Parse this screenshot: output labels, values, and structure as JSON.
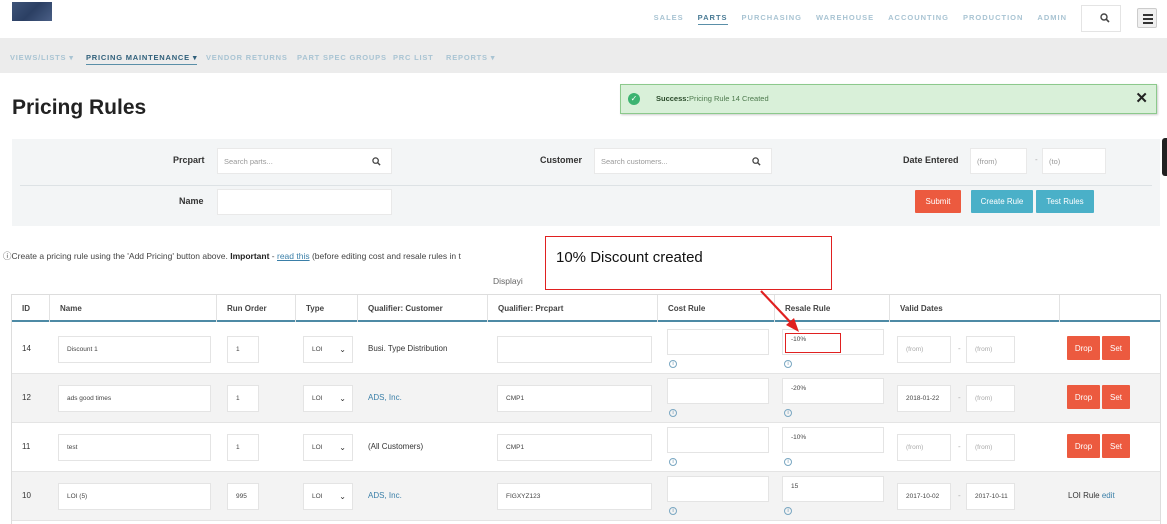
{
  "topnav": {
    "items": [
      "SALES",
      "PARTS",
      "PURCHASING",
      "WAREHOUSE",
      "ACCOUNTING",
      "PRODUCTION",
      "ADMIN"
    ],
    "active": "PARTS"
  },
  "subnav": {
    "items": [
      "VIEWS/LISTS ▾",
      "PRICING MAINTENANCE ▾",
      "VENDOR RETURNS",
      "PART SPEC GROUPS",
      "PRC LIST",
      "REPORTS ▾"
    ],
    "active": "PRICING MAINTENANCE ▾"
  },
  "page_title": "Pricing Rules",
  "alert": {
    "label": "Success:",
    "message": "Pricing Rule 14 Created",
    "close": "✕"
  },
  "filter": {
    "prcpart_label": "Prcpart",
    "prcpart_placeholder": "Search parts...",
    "customer_label": "Customer",
    "customer_placeholder": "Search customers...",
    "date_label": "Date Entered",
    "date_from": "(from)",
    "date_sep": "-",
    "date_to": "(to)",
    "name_label": "Name",
    "name_value": "",
    "submit": "Submit",
    "create_rule": "Create Rule",
    "test_rules": "Test Rules"
  },
  "info": {
    "icon": "ⓘ",
    "text1": "Create a pricing rule using the 'Add Pricing' button above. ",
    "important": "Important",
    "text2": " - ",
    "link": "read this",
    "text3": " (before editing cost and resale rules in t",
    "displaying": "Displayi"
  },
  "annotation": {
    "text": "10% Discount created"
  },
  "table": {
    "headers": [
      "ID",
      "Name",
      "Run Order",
      "Type",
      "Qualifier: Customer",
      "Qualifier: Prcpart",
      "Cost Rule",
      "Resale Rule",
      "Valid Dates",
      ""
    ],
    "rows": [
      {
        "id": "14",
        "name": "Discount 1",
        "run_order": "1",
        "type": "LOI",
        "customer": "Busi. Type Distribution",
        "customer_link": false,
        "prcpart": "",
        "cost_rule": "",
        "resale_rule": "-10%",
        "valid_from": "(from)",
        "valid_to": "(from)",
        "from_placeholder": true,
        "to_placeholder": true,
        "actions": [
          "Drop",
          "Set"
        ]
      },
      {
        "id": "12",
        "name": "ads good times",
        "run_order": "1",
        "type": "LOI",
        "customer": "ADS, Inc.",
        "customer_link": true,
        "prcpart": "CMP1",
        "cost_rule": "",
        "resale_rule": "-20%",
        "valid_from": "2018-01-22",
        "valid_to": "(from)",
        "from_placeholder": false,
        "to_placeholder": true,
        "actions": [
          "Drop",
          "Set"
        ]
      },
      {
        "id": "11",
        "name": "test",
        "run_order": "1",
        "type": "LOI",
        "customer": "(All Customers)",
        "customer_link": false,
        "prcpart": "CMP1",
        "cost_rule": "",
        "resale_rule": "-10%",
        "valid_from": "(from)",
        "valid_to": "(from)",
        "from_placeholder": true,
        "to_placeholder": true,
        "actions": [
          "Drop",
          "Set"
        ]
      },
      {
        "id": "10",
        "name": "LOI (5)",
        "run_order": "995",
        "type": "LOI",
        "customer": "ADS, Inc.",
        "customer_link": true,
        "prcpart": "FIGXYZ123",
        "cost_rule": "",
        "resale_rule": "15",
        "valid_from": "2017-10-02",
        "valid_to": "2017-10-11",
        "from_placeholder": false,
        "to_placeholder": false,
        "actions": [],
        "loi_label": "LOI Rule",
        "loi_edit": "edit"
      }
    ]
  },
  "colors": {
    "accent": "#4d8aa5",
    "danger": "#ec5a3f",
    "teal": "#4ab0c8",
    "success_bg": "#d9f0d9",
    "annotation": "#e02020"
  }
}
